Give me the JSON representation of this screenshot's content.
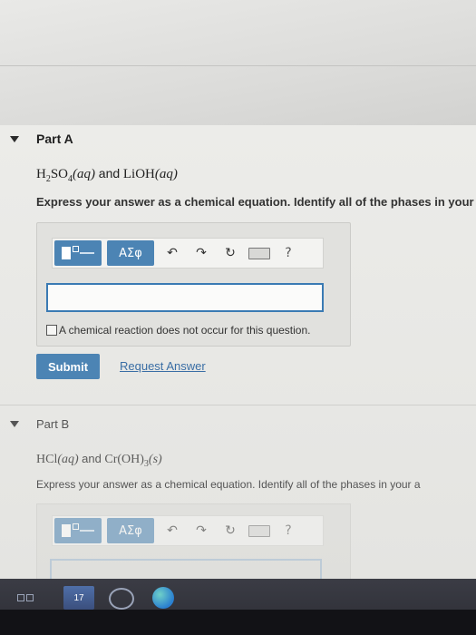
{
  "partA": {
    "title": "Part A",
    "question": {
      "reactant1": "H",
      "r1sub1": "2",
      "r1mid": "SO",
      "r1sub2": "4",
      "phase1": "(aq)",
      "and": "and",
      "reactant2": "LiOH",
      "phase2": "(aq)"
    },
    "instruction": "Express your answer as a chemical equation. Identify all of the phases in your",
    "toolbar": {
      "symbols_label": "ΑΣφ",
      "help_label": "?"
    },
    "answer_value": "",
    "no_reaction_label": "A chemical reaction does not occur for this question.",
    "submit_label": "Submit",
    "request_label": "Request Answer"
  },
  "partB": {
    "title": "Part B",
    "question": {
      "reactant1": "HCl",
      "phase1": "(aq)",
      "and": "and",
      "reactant2": "Cr(OH)",
      "r2sub": "3",
      "phase2": "(s)"
    },
    "instruction": "Express your answer as a chemical equation. Identify all of the phases in your a",
    "toolbar": {
      "symbols_label": "ΑΣφ",
      "help_label": "?"
    }
  },
  "taskbar": {
    "calendar_badge": "17"
  },
  "colors": {
    "accent": "#4c84b4",
    "link": "#3a6ea5",
    "input_border": "#3a7ab3"
  }
}
